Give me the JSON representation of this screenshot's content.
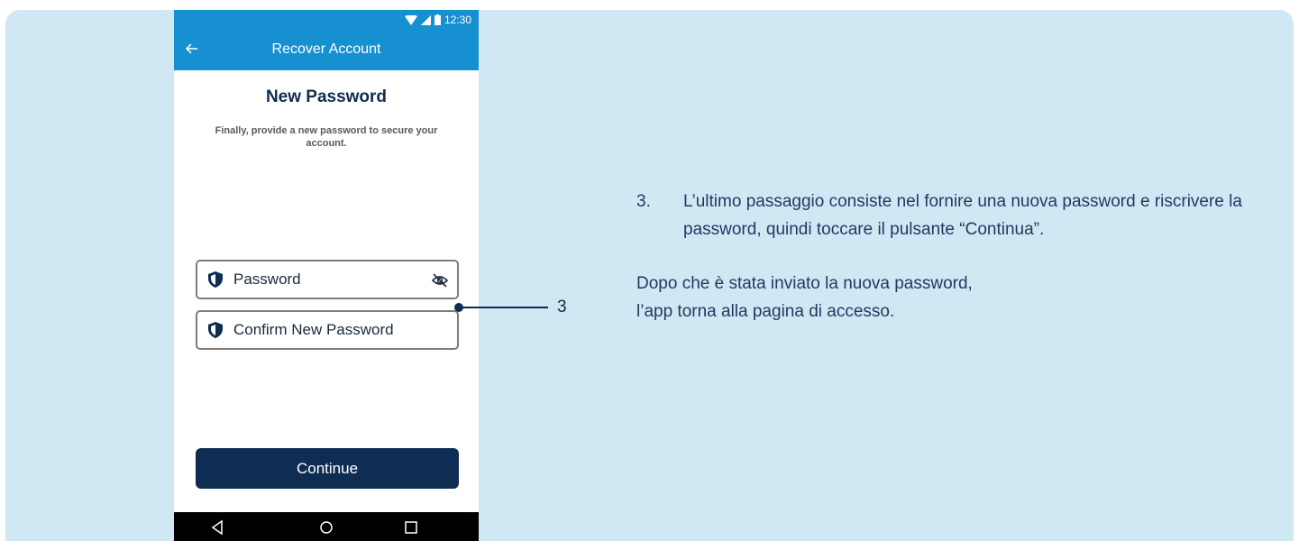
{
  "phone": {
    "status_bar": {
      "time": "12:30"
    },
    "app_bar": {
      "title": "Recover Account"
    },
    "heading": "New Password",
    "subtitle": "Finally, provide a new password to secure your account.",
    "fields": {
      "password": {
        "label": "Password"
      },
      "confirm": {
        "label": "Confirm New Password"
      }
    },
    "continue_label": "Continue",
    "icons": {
      "back": "arrow-left-icon",
      "shield": "shield-icon",
      "eye_off": "eye-off-icon",
      "nav_back": "triangle-back-icon",
      "nav_home": "circle-home-icon",
      "nav_recents": "square-recents-icon"
    }
  },
  "callout": {
    "number": "3"
  },
  "instructions": {
    "step_number": "3.",
    "step_text": "L’ultimo passaggio consiste nel fornire una nuova password e riscrivere la password, quindi toccare il pulsante “Continua”.",
    "note_line1": "Dopo che è stata inviato la nuova password,",
    "note_line2": "l’app torna alla pagina di accesso."
  },
  "colors": {
    "panel_bg": "#cfe8f4",
    "app_bar": "#1690d0",
    "primary_navy": "#0f2d52",
    "text": "#1c3b5e"
  }
}
